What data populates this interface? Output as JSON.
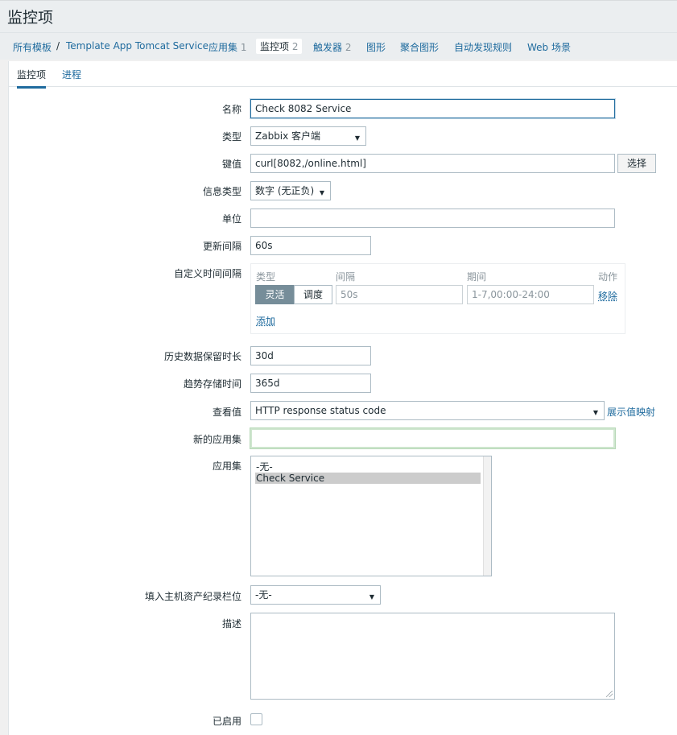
{
  "page": {
    "title": "监控项"
  },
  "breadcrumbs": [
    {
      "label": "所有模板"
    },
    {
      "label": "Template App Tomcat Service"
    },
    {
      "label": "应用集",
      "count": "1"
    },
    {
      "label": "监控项",
      "count": "2"
    },
    {
      "label": "触发器",
      "count": "2"
    },
    {
      "label": "图形"
    },
    {
      "label": "聚合图形"
    },
    {
      "label": "自动发现规则"
    },
    {
      "label": "Web 场景"
    }
  ],
  "breadcrumb_separator": "/",
  "tabs": [
    {
      "label": "监控项"
    },
    {
      "label": "进程"
    }
  ],
  "form": {
    "name": {
      "label": "名称",
      "value": "Check 8082 Service"
    },
    "type": {
      "label": "类型",
      "value": "Zabbix 客户端"
    },
    "key": {
      "label": "键值",
      "value": "curl[8082,/online.html]",
      "select_label": "选择"
    },
    "info_type": {
      "label": "信息类型",
      "value": "数字 (无正负)"
    },
    "units": {
      "label": "单位",
      "value": ""
    },
    "update_interval": {
      "label": "更新间隔",
      "value": "60s"
    },
    "custom_intervals": {
      "label": "自定义时间间隔",
      "headers": {
        "type": "类型",
        "interval": "间隔",
        "period": "期间",
        "action": "动作"
      },
      "row": {
        "flexible": "灵活",
        "scheduling": "调度",
        "interval_placeholder": "50s",
        "period_placeholder": "1-7,00:00-24:00",
        "remove": "移除"
      },
      "add": "添加"
    },
    "history": {
      "label": "历史数据保留时长",
      "value": "30d"
    },
    "trends": {
      "label": "趋势存储时间",
      "value": "365d"
    },
    "valuemap": {
      "label": "查看值",
      "value": "HTTP response status code",
      "link": "展示值映射"
    },
    "new_application": {
      "label": "新的应用集",
      "value": ""
    },
    "applications": {
      "label": "应用集",
      "items": [
        "-无-",
        "Check Service"
      ]
    },
    "inventory": {
      "label": "填入主机资产纪录栏位",
      "value": "-无-"
    },
    "description": {
      "label": "描述"
    },
    "enabled": {
      "label": "已启用"
    }
  },
  "colors": {
    "link": "#1f6b9e",
    "active_tab_border": "#1f6b9e",
    "segment_active": "#768d99"
  }
}
